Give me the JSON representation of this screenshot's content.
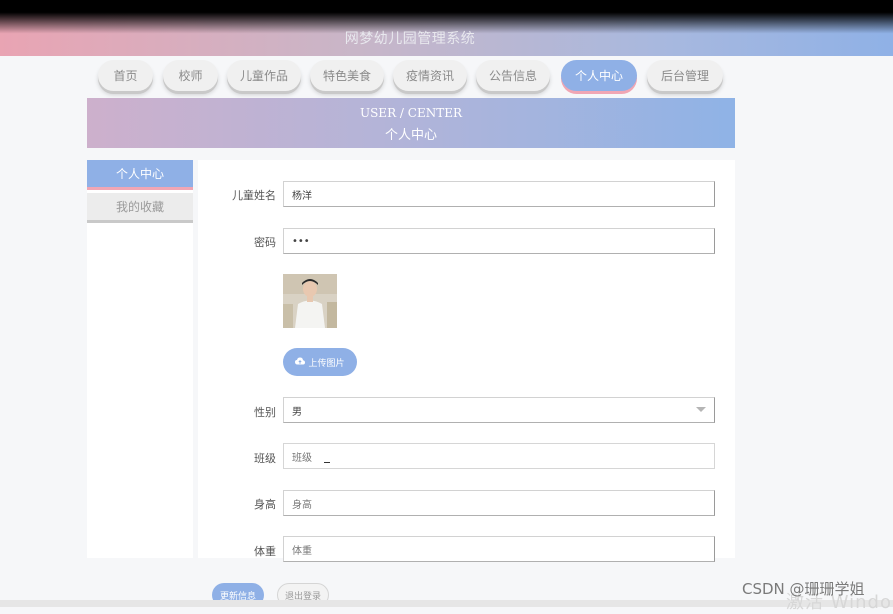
{
  "app": {
    "title": "网梦幼儿园管理系统"
  },
  "nav": [
    {
      "label": "首页"
    },
    {
      "label": "校师"
    },
    {
      "label": "儿童作品"
    },
    {
      "label": "特色美食"
    },
    {
      "label": "疫情资讯"
    },
    {
      "label": "公告信息"
    },
    {
      "label": "个人中心",
      "active": true
    },
    {
      "label": "后台管理"
    }
  ],
  "banner": {
    "en": "USER / CENTER",
    "cn": "个人中心"
  },
  "sidebar": {
    "items": [
      {
        "label": "个人中心",
        "active": true
      },
      {
        "label": "我的收藏",
        "active": false
      }
    ]
  },
  "form": {
    "child_name": {
      "label": "儿童姓名",
      "value": "杨洋"
    },
    "password": {
      "label": "密码",
      "value": "•••"
    },
    "upload_button": "上传图片",
    "gender": {
      "label": "性别",
      "value": "男"
    },
    "class": {
      "label": "班级",
      "value": "班级"
    },
    "height": {
      "label": "身高",
      "value": "身高"
    },
    "weight": {
      "label": "体重",
      "value": "体重"
    }
  },
  "actions": {
    "update": "更新信息",
    "logout": "退出登录"
  },
  "overlay": {
    "watermark": "激活 Windo",
    "csdn": "CSDN @珊珊学姐"
  },
  "colors": {
    "accent": "#8fb0e6",
    "pink_accent": "#f0a6b4"
  },
  "icons": {
    "upload": "cloud-upload-icon",
    "select": "chevron-down-icon"
  }
}
